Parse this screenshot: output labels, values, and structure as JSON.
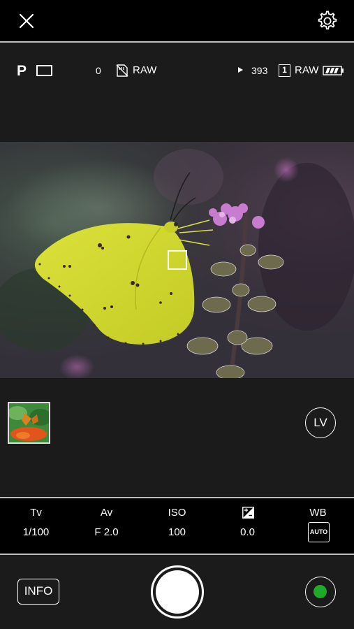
{
  "top_bar": {
    "close_icon": "close-icon",
    "settings_icon": "gear-icon"
  },
  "status_bar": {
    "shooting_mode": "P",
    "drive_mode_icon": "single-shot-icon",
    "exposure_count": "0",
    "card_icon": "no-card-icon",
    "quality_left": "RAW",
    "playback_icon": "play-icon",
    "shots_remaining": "393",
    "card_slot": "1",
    "quality_right": "RAW",
    "battery_icon": "battery-icon",
    "battery_level": 0.75
  },
  "live_view": {
    "focus_point_icon": "af-point-icon"
  },
  "controls": {
    "lv_label": "LV",
    "thumbnail_icon": "last-photo-thumbnail"
  },
  "settings": {
    "tv": {
      "label": "Tv",
      "value": "1/100"
    },
    "av": {
      "label": "Av",
      "value": "F 2.0"
    },
    "iso": {
      "label": "ISO",
      "value": "100"
    },
    "exposure": {
      "icon": "exposure-compensation-icon",
      "value": "0.0"
    },
    "wb": {
      "label": "WB",
      "value": "AUTO"
    }
  },
  "bottom_bar": {
    "info_label": "INFO",
    "shutter_icon": "shutter-button",
    "record_icon": "record-icon",
    "record_color": "#1faa2b"
  }
}
